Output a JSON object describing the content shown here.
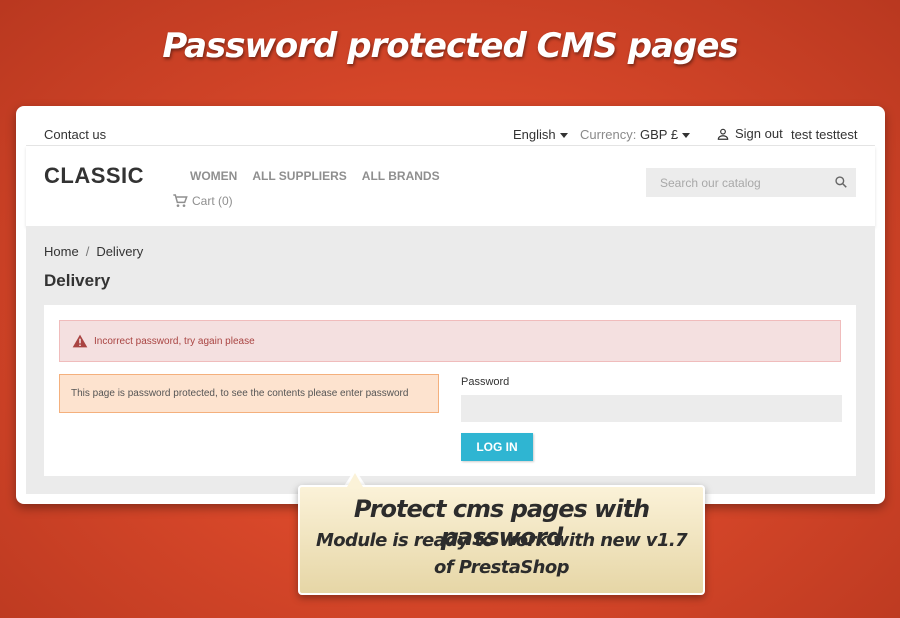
{
  "banner": {
    "title": "Password protected CMS pages"
  },
  "topbar": {
    "contact": "Contact us",
    "language": "English",
    "currency_label": "Currency:",
    "currency_value": "GBP £",
    "signout": "Sign out",
    "username": "test testtest"
  },
  "header": {
    "logo": "CLASSIC",
    "menu": [
      "WOMEN",
      "ALL SUPPLIERS",
      "ALL BRANDS"
    ],
    "cart": "Cart (0)",
    "search_placeholder": "Search our catalog"
  },
  "breadcrumb": [
    "Home",
    "Delivery"
  ],
  "page": {
    "title": "Delivery",
    "error": "Incorrect password, try again please",
    "info": "This page is password protected, to see the contents please enter password",
    "password_label": "Password",
    "password_value": "",
    "login_label": "LOG IN"
  },
  "callout": {
    "line1": "Protect cms pages with password",
    "line2": "Module is ready to work with new v1.7",
    "line3": "of PrestaShop"
  },
  "colors": {
    "background": "#d9482a",
    "accent": "#2fb5d2",
    "danger_bg": "#f4e0e0",
    "danger_text": "#a94442",
    "info_bg": "#fde3cf"
  },
  "icons": [
    "user-icon",
    "cart-icon",
    "search-icon",
    "warning-icon"
  ]
}
